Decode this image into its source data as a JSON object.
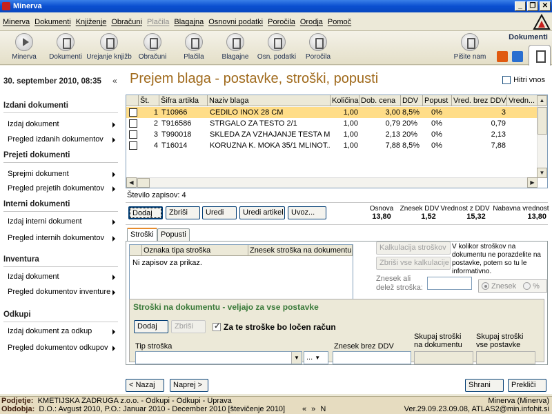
{
  "window": {
    "title": "Minerva"
  },
  "menu": [
    "Minerva",
    "Dokumenti",
    "Knjiženje",
    "Obračuni",
    "Plačila",
    "Blagajna",
    "Osnovni podatki",
    "Poročila",
    "Orodja",
    "Pomoč"
  ],
  "menu_disabled_index": 4,
  "toolbar": {
    "items": [
      "Minerva",
      "Dokumenti",
      "Urejanje knjižb",
      "Obračuni",
      "Plačila",
      "Blagajne",
      "Osn. podatki",
      "Poročila"
    ],
    "right_item": "Pišite nam",
    "section_label": "Dokumenti"
  },
  "sidebar": {
    "date": "30. september 2010, 08:35",
    "collapse": "«",
    "sections": [
      {
        "title": "Izdani dokumenti",
        "items": [
          "Izdaj dokument",
          "Pregled izdanih dokumentov"
        ]
      },
      {
        "title": "Prejeti dokumenti",
        "items": [
          "Sprejmi dokument",
          "Pregled prejetih dokumentov"
        ]
      },
      {
        "title": "Interni dokumenti",
        "items": [
          "Izdaj interni dokument",
          "Pregled internih dokumentov"
        ]
      },
      {
        "title": "Inventura",
        "items": [
          "Izdaj dokument",
          "Pregled dokumentov inventure"
        ]
      },
      {
        "title": "Odkupi",
        "items": [
          "Izdaj dokument za odkup",
          "Pregled dokumentov odkupov"
        ]
      }
    ]
  },
  "main": {
    "title": "Prejem blaga - postavke, stroški, popusti",
    "fast_entry": "Hitri vnos",
    "columns": [
      "Št.",
      "Šifra artikla",
      "Naziv blaga",
      "Količina",
      "Dob. cena",
      "DDV",
      "Popust",
      "Vred. brez DDV",
      "Vredn..."
    ],
    "rows": [
      [
        "1",
        "T10966",
        "CEDILO INOX 28 CM",
        "1,00",
        "3,00",
        "8,5%",
        "0%",
        "3"
      ],
      [
        "2",
        "T916586",
        "STRGALO ZA TESTO 2/1",
        "1,00",
        "0,79",
        "20%",
        "0%",
        "0,79"
      ],
      [
        "3",
        "T990018",
        "SKLEDA ZA VZHAJANJE TESTA M...",
        "1,00",
        "2,13",
        "20%",
        "0%",
        "2,13"
      ],
      [
        "4",
        "T16014",
        "KORUZNA K. MOKA 35/1 MLINOT...",
        "1,00",
        "7,88",
        "8,5%",
        "0%",
        "7,88"
      ]
    ],
    "count": "Število zapisov: 4",
    "buttons": [
      "Dodaj",
      "Zbriši",
      "Uredi",
      "Uredi artikel",
      "Uvoz..."
    ],
    "totals": [
      {
        "label": "Osnova",
        "value": "13,80"
      },
      {
        "label": "Znesek DDV",
        "value": "1,52"
      },
      {
        "label": "Vrednost z DDV",
        "value": "15,32"
      },
      {
        "label": "Nabavna vrednost",
        "value": "13,80"
      }
    ],
    "tabs": [
      "Stroški",
      "Popusti"
    ],
    "cost_columns": [
      "Oznaka tipa stroška",
      "Znesek stroška na dokumentu"
    ],
    "no_records": "Ni zapisov za prikaz.",
    "calc_button": "Kalkulacija stroškov",
    "delete_calc_button": "Zbriši vse kalkulacije",
    "info_text": "V kolikor stroškov na dokumentu ne porazdelite na postavke, potem so tu le informativno.",
    "share_label_1": "Znesek ali",
    "share_label_2": "delež stroška:",
    "radio_amount": "Znesek",
    "radio_percent": "%",
    "group": {
      "title": "Stroški na dokumentu - veljajo za vse postavke",
      "add": "Dodaj",
      "delete": "Zbriši",
      "separate_invoice": "Za te stroške bo ločen račun",
      "type_label": "Tip stroška",
      "ellipsis": "...",
      "net_label": "Znesek brez DDV",
      "doc_total_1": "Skupaj stroški",
      "doc_total_2": "na dokumentu",
      "all_total_1": "Skupaj stroški",
      "all_total_2": "vse postavke"
    },
    "back": "< Nazaj",
    "next": "Naprej >",
    "save": "Shrani",
    "cancel": "Prekliči"
  },
  "status": {
    "company_label": "Podjetje:",
    "company": "KMETIJSKA ZADRUGA z.o.o. - Odkupi - Odkupi - Uprava",
    "app": "Minerva (Minerva)",
    "period_label": "Obdobja:",
    "period": "D.O.: Avgust 2010, P.O.: Januar 2010 - December 2010 [števičenje 2010]",
    "nav": "«  »  N",
    "version": "Ver.29.09.23.09.08, ATLAS2@min.infohit.si"
  },
  "colors": {
    "title_orange": "#a06a1c",
    "selected_row": "#ffdd88",
    "group_title": "#3a7a3a"
  }
}
